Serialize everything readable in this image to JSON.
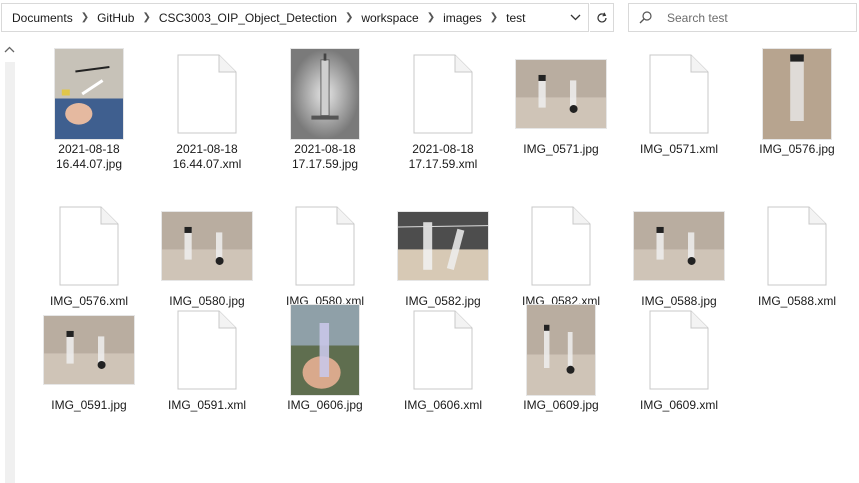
{
  "address_bar": {
    "breadcrumbs": [
      "Documents",
      "GitHub",
      "CSC3003_OIP_Object_Detection",
      "workspace",
      "images",
      "test"
    ]
  },
  "search": {
    "placeholder": "Search test"
  },
  "files": [
    {
      "name": "2021-08-18\n16.44.07.jpg",
      "type": "photo",
      "icon": "photo-hand-syringes"
    },
    {
      "name": "2021-08-18\n16.44.07.xml",
      "type": "xml",
      "icon": "document-icon"
    },
    {
      "name": "2021-08-18\n17.17.59.jpg",
      "type": "photo",
      "icon": "photo-syringe"
    },
    {
      "name": "2021-08-18\n17.17.59.xml",
      "type": "xml",
      "icon": "document-icon"
    },
    {
      "name": "IMG_0571.jpg",
      "type": "photo",
      "icon": "photo-syringes-table"
    },
    {
      "name": "IMG_0571.xml",
      "type": "xml",
      "icon": "document-icon"
    },
    {
      "name": "IMG_0576.jpg",
      "type": "photo",
      "icon": "photo-tube"
    },
    {
      "name": "IMG_0576.xml",
      "type": "xml",
      "icon": "document-icon"
    },
    {
      "name": "IMG_0580.jpg",
      "type": "photo",
      "icon": "photo-syringes-table"
    },
    {
      "name": "IMG_0580.xml",
      "type": "xml",
      "icon": "document-icon"
    },
    {
      "name": "IMG_0582.jpg",
      "type": "photo",
      "icon": "photo-syringes-lit"
    },
    {
      "name": "IMG_0582.xml",
      "type": "xml",
      "icon": "document-icon"
    },
    {
      "name": "IMG_0588.jpg",
      "type": "photo",
      "icon": "photo-syringes-table"
    },
    {
      "name": "IMG_0588.xml",
      "type": "xml",
      "icon": "document-icon"
    },
    {
      "name": "IMG_0591.jpg",
      "type": "photo",
      "icon": "photo-syringes-table"
    },
    {
      "name": "IMG_0591.xml",
      "type": "xml",
      "icon": "document-icon"
    },
    {
      "name": "IMG_0606.jpg",
      "type": "photo",
      "icon": "photo-hand-syringe"
    },
    {
      "name": "IMG_0606.xml",
      "type": "xml",
      "icon": "document-icon"
    },
    {
      "name": "IMG_0609.jpg",
      "type": "photo",
      "icon": "photo-syringes-table"
    },
    {
      "name": "IMG_0609.xml",
      "type": "xml",
      "icon": "document-icon"
    }
  ]
}
